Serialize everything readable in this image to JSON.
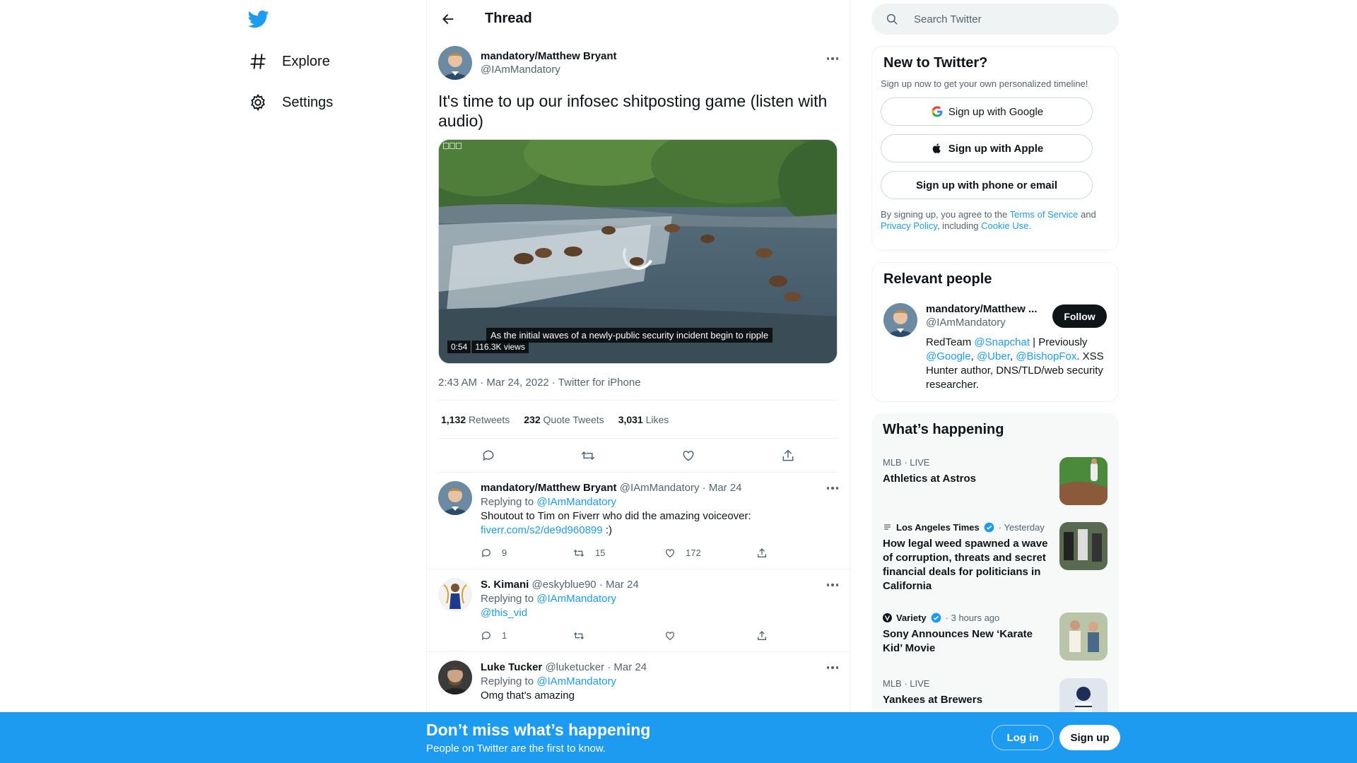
{
  "nav": {
    "items": [
      {
        "label": "Explore",
        "icon": "hashtag-icon"
      },
      {
        "label": "Settings",
        "icon": "gear-icon"
      }
    ]
  },
  "thread": {
    "title": "Thread",
    "tweet": {
      "author_name": "mandatory/Matthew Bryant",
      "author_handle": "@IAmMandatory",
      "text": "It's time to up our infosec shitposting game (listen with audio)",
      "video_caption": "As the initial waves of a newly-public security incident begin to ripple",
      "video_duration": "0:54",
      "video_views": "116.3K views",
      "timestamp": "2:43 AM · Mar 24, 2022 · Twitter for iPhone",
      "stats": [
        {
          "count": "1,132",
          "label": "Retweets"
        },
        {
          "count": "232",
          "label": "Quote Tweets"
        },
        {
          "count": "3,031",
          "label": "Likes"
        }
      ]
    },
    "replies": [
      {
        "name": "mandatory/Matthew Bryant",
        "handle": "@IAmMandatory",
        "date": "· Mar 24",
        "replying_label": "Replying to",
        "replying_to": "@IAmMandatory",
        "text": "Shoutout to Tim on Fiverr who did the amazing voiceover:",
        "link": "fiverr.com/s2/de9d960899",
        "text_after": " :)",
        "reply_count": "9",
        "retweet_count": "15",
        "like_count": "172"
      },
      {
        "name": "S. Kimani",
        "handle": "@eskyblue90",
        "date": "· Mar 24",
        "replying_label": "Replying to",
        "replying_to": "@IAmMandatory",
        "link": "@this_vid",
        "reply_count": "1",
        "retweet_count": "",
        "like_count": ""
      },
      {
        "name": "Luke Tucker",
        "handle": "@luketucker",
        "date": "· Mar 24",
        "replying_label": "Replying to",
        "replying_to": "@IAmMandatory",
        "text": "Omg that's amazing"
      }
    ]
  },
  "sidebar": {
    "search_placeholder": "Search Twitter",
    "new_to_twitter": {
      "title": "New to Twitter?",
      "subtitle": "Sign up now to get your own personalized timeline!",
      "google_label": "Sign up with Google",
      "apple_label": "Sign up with Apple",
      "phone_label": "Sign up with phone or email",
      "terms_pre": "By signing up, you agree to the ",
      "terms_link": "Terms of Service",
      "terms_and": " and ",
      "privacy_link": "Privacy Policy",
      "terms_including": ", including ",
      "cookie_link": "Cookie Use."
    },
    "relevant_people": {
      "title": "Relevant people",
      "name": "mandatory/Matthew ...",
      "handle": "@IAmMandatory",
      "follow_label": "Follow",
      "bio_1": "RedTeam ",
      "bio_link_snapchat": "@Snapchat",
      "bio_2": " | Previously ",
      "bio_link_google": "@Google",
      "bio_comma1": ", ",
      "bio_link_uber": "@Uber",
      "bio_comma2": ", ",
      "bio_link_bishopfox": "@BishopFox",
      "bio_3": ". XSS Hunter author, DNS/TLD/web security researcher."
    },
    "happening": {
      "title": "What’s happening",
      "trends": [
        {
          "meta": "MLB · LIVE",
          "title": "Athletics at Astros"
        },
        {
          "source": "Los Angeles Times",
          "time": "· Yesterday",
          "title": "How legal weed spawned a wave of corruption, threats and secret financial deals for politicians in California"
        },
        {
          "source": "Variety",
          "time": "· 3 hours ago",
          "title": "Sony Announces New ‘Karate Kid’ Movie"
        },
        {
          "meta": "MLB · LIVE",
          "title": "Yankees at Brewers"
        }
      ]
    }
  },
  "banner": {
    "title": "Don’t miss what’s happening",
    "subtitle": "People on Twitter are the first to know.",
    "login_label": "Log in",
    "signup_label": "Sign up"
  },
  "colors": {
    "brand": "#1d9bf0",
    "text": "#0f1419",
    "muted": "#536471"
  }
}
